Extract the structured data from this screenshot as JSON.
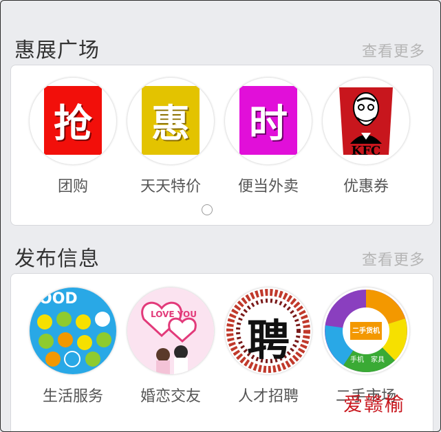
{
  "promo": {
    "title": "惠展广场",
    "more": "查看更多",
    "items": [
      {
        "label": "团购",
        "glyph": "抢",
        "color": "#f20f0a",
        "icon": "grab-deal-icon"
      },
      {
        "label": "天天特价",
        "glyph": "惠",
        "color": "#e3c300",
        "icon": "discount-icon"
      },
      {
        "label": "便当外卖",
        "glyph": "时",
        "color": "#e10fd9",
        "icon": "time-icon"
      },
      {
        "label": "优惠券",
        "glyph": "KFC",
        "color": "#c8161d",
        "icon": "kfc-logo-icon"
      }
    ]
  },
  "info": {
    "title": "发布信息",
    "more": "查看更多",
    "items": [
      {
        "label": "生活服务",
        "text": "OOD",
        "icon": "life-service-icon"
      },
      {
        "label": "婚恋交友",
        "text": "LOVE YOU",
        "icon": "love-heart-icon"
      },
      {
        "label": "人才招聘",
        "text": "聘",
        "icon": "recruit-icon"
      },
      {
        "label": "二手市场",
        "text": "二手货机",
        "icon": "second-hand-icon",
        "sub": [
          "手机",
          "家具"
        ]
      }
    ]
  },
  "watermark": "爱赣榆"
}
